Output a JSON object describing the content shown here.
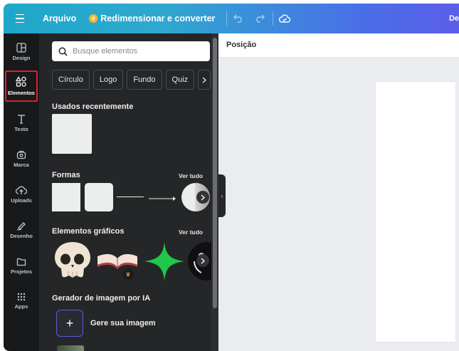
{
  "topbar": {
    "file_label": "Arquivo",
    "resize_label": "Redimensionar e converter",
    "right_label": "De"
  },
  "rail": {
    "items": [
      {
        "label": "Design",
        "icon": "layout-icon"
      },
      {
        "label": "Elementos",
        "icon": "shapes-icon"
      },
      {
        "label": "Texto",
        "icon": "text-icon"
      },
      {
        "label": "Marca",
        "icon": "brand-icon"
      },
      {
        "label": "Uploads",
        "icon": "upload-cloud-icon"
      },
      {
        "label": "Desenho",
        "icon": "pen-icon"
      },
      {
        "label": "Projetos",
        "icon": "folder-icon"
      },
      {
        "label": "Apps",
        "icon": "apps-grid-icon"
      }
    ]
  },
  "panel": {
    "search_placeholder": "Busque elementos",
    "chips": [
      "Círculo",
      "Logo",
      "Fundo",
      "Quiz"
    ],
    "recent_title": "Usados recentemente",
    "shapes_title": "Formas",
    "graphics_title": "Elementos gráficos",
    "see_all": "Ver tudo",
    "ai_title": "Gerador de imagem por IA",
    "ai_action": "Gere sua imagem"
  },
  "editor": {
    "position_label": "Posição"
  },
  "colors": {
    "accent": "#1ea7c9",
    "accent_end": "#5b5ee8",
    "panel_bg": "#252627",
    "rail_bg": "#18191b",
    "highlight": "#e01e2c",
    "star_green": "#1fc74a"
  }
}
